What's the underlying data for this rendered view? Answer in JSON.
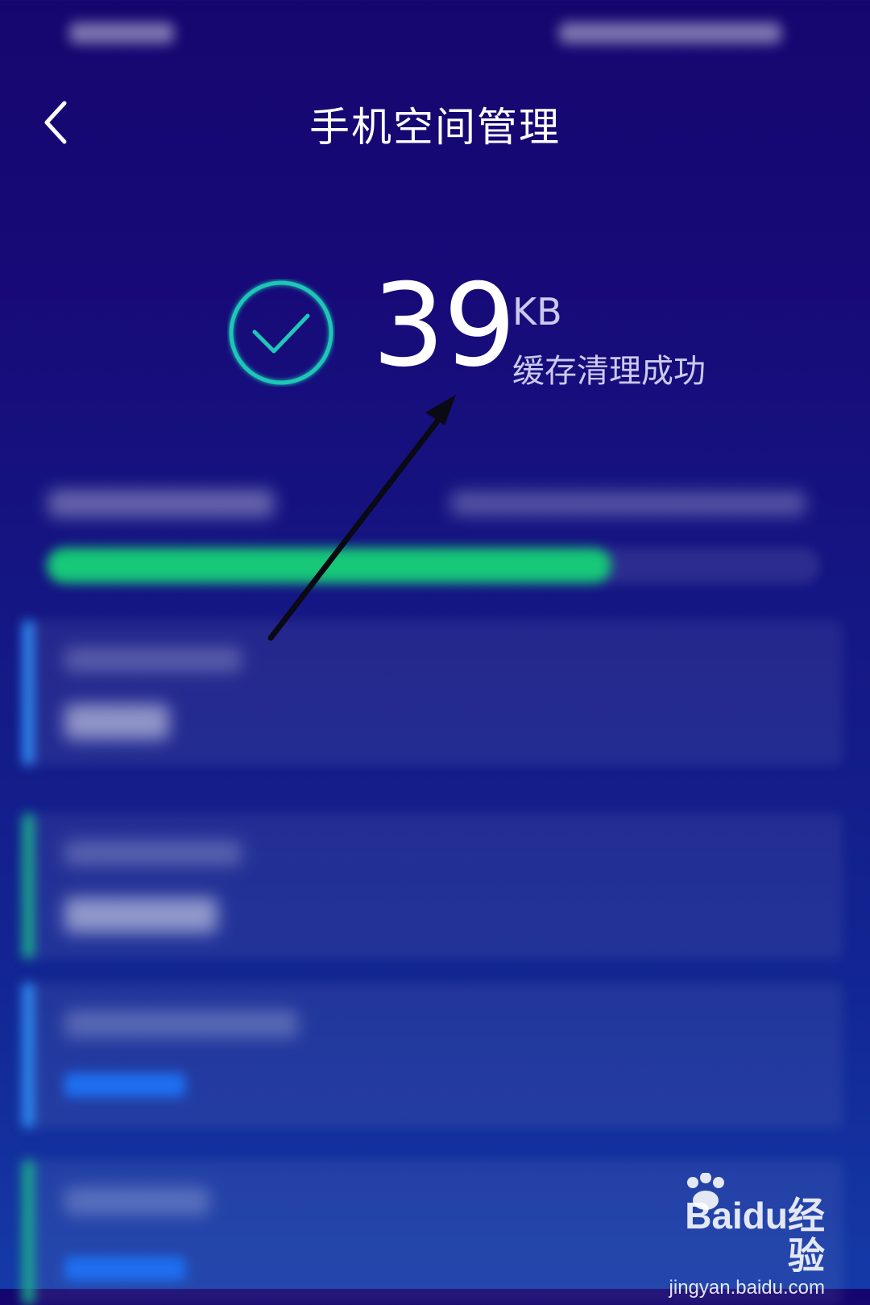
{
  "header": {
    "title": "手机空间管理",
    "back_icon": "chevron-left-icon"
  },
  "result": {
    "value": "39",
    "unit": "KB",
    "caption": "缓存清理成功",
    "icon": "check-circle-icon",
    "accent_color": "#1fc7b6"
  },
  "storage": {
    "used_fraction": 0.73,
    "bar_color": "#16c878"
  },
  "cards": [
    {
      "accent_color": "#2f8ff5"
    },
    {
      "accent_color": "#1bb08c"
    },
    {
      "accent_color": "#2f8ff5"
    },
    {
      "accent_color": "#1bb08c"
    }
  ],
  "watermark": {
    "brand": "Baidu经验",
    "url": "jingyan.baidu.com"
  }
}
